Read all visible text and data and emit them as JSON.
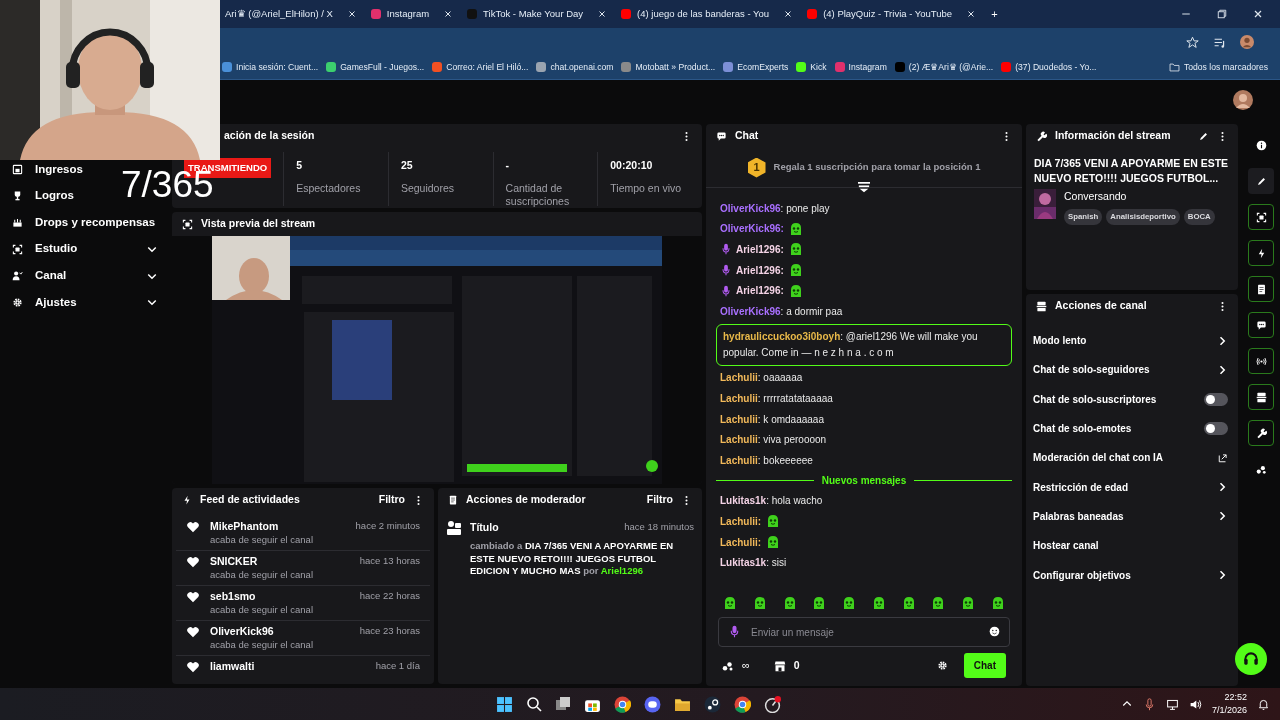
{
  "browser": {
    "tabs": [
      {
        "label": "Ari♛ (@Ariel_ElHilon) / X",
        "icon": false
      },
      {
        "label": "Instagram",
        "icon": true,
        "color": "#e1306c"
      },
      {
        "label": "TikTok - Make Your Day",
        "icon": true,
        "color": "#111111"
      },
      {
        "label": "(4) juego de las banderas - You",
        "icon": true,
        "color": "#ff0000"
      },
      {
        "label": "(4) PlayQuiz - Trivia - YouTube",
        "icon": true,
        "color": "#ff0000"
      }
    ],
    "new_tab": "+",
    "bookmarks": [
      {
        "label": "Inicia sesión: Cuent...",
        "color": "#4a90d9"
      },
      {
        "label": "GamesFull - Juegos...",
        "color": "#3ccf6e"
      },
      {
        "label": "Correo: Ariel El Hiló...",
        "color": "#f25022"
      },
      {
        "label": "chat.openai.com",
        "color": "#9aa4b0"
      },
      {
        "label": "Motobatt » Product...",
        "color": "#8a8a8a"
      },
      {
        "label": "EcomExperts",
        "color": "#7c8fd6"
      },
      {
        "label": "Kick",
        "color": "#53fc18"
      },
      {
        "label": "Instagram",
        "color": "#e1306c"
      },
      {
        "label": "(2) Æ♛Ari♛ (@Arie...",
        "color": "#000000"
      },
      {
        "label": "(37) Duodedos - Yo...",
        "color": "#ff0000"
      }
    ],
    "all_bookmarks": "Todos los marcadores"
  },
  "overlay_text": "7/365",
  "sidebar": [
    {
      "label": "Ingresos",
      "expandable": false
    },
    {
      "label": "Logros",
      "expandable": false
    },
    {
      "label": "Drops y recompensas",
      "expandable": false
    },
    {
      "label": "Estudio",
      "expandable": true
    },
    {
      "label": "Canal",
      "expandable": true
    },
    {
      "label": "Ajustes",
      "expandable": true
    }
  ],
  "session": {
    "title": "ación de la sesión",
    "status": "TRANSMITIENDO",
    "stats": [
      {
        "value": "5",
        "label": "Espectadores"
      },
      {
        "value": "25",
        "label": "Seguidores"
      },
      {
        "value": "-",
        "label": "Cantidad de suscripciones"
      },
      {
        "value": "00:20:10",
        "label": "Tiempo en vivo"
      }
    ]
  },
  "preview": {
    "title": "Vista previa del stream",
    "kind": "picture"
  },
  "feed": {
    "title": "Feed de actividades",
    "filter": "Filtro",
    "items": [
      {
        "name": "MikePhantom",
        "time": "hace 2 minutos",
        "text": "acaba de seguir el canal"
      },
      {
        "name": "SNICKER",
        "time": "hace 13 horas",
        "text": "acaba de seguir el canal"
      },
      {
        "name": "seb1smo",
        "time": "hace 22 horas",
        "text": "acaba de seguir el canal"
      },
      {
        "name": "OliverKick96",
        "time": "hace 23 horas",
        "text": "acaba de seguir el canal"
      },
      {
        "name": "liamwalti",
        "time": "hace 1 día"
      }
    ]
  },
  "moderator": {
    "title": "Acciones de moderador",
    "filter": "Filtro",
    "entries": [
      {
        "title": "Título",
        "time": "hace 18 minutos",
        "text": "cambiado a **DIA 7/365 VENI A APOYARME EN ESTE NUEVO RETO!!!! JUEGOS FUTBOL EDICION Y MUCHO MAS** por",
        "user": "Ariel1296"
      }
    ]
  },
  "chat": {
    "title": "Chat",
    "gift": {
      "rank": "1",
      "text": "Regala 1 suscripción para tomar la posición 1"
    },
    "messages": [
      {
        "kind": "text",
        "user": "OliverKick96",
        "color": "#a970ff",
        "text": "pone play",
        "mic": false,
        "highlighted": false
      },
      {
        "kind": "emote",
        "user": "OliverKick96",
        "color": "#a970ff",
        "mic": false,
        "highlighted": false
      },
      {
        "kind": "emote",
        "user": "Ariel1296",
        "color": "#f4d3e6",
        "mic": true,
        "highlighted": false
      },
      {
        "kind": "emote",
        "user": "Ariel1296",
        "color": "#f4d3e6",
        "mic": true,
        "highlighted": false
      },
      {
        "kind": "emote",
        "user": "Ariel1296",
        "color": "#f4d3e6",
        "mic": true,
        "highlighted": false
      },
      {
        "kind": "text",
        "user": "OliverKick96",
        "color": "#a970ff",
        "text": "a dormir paa",
        "mic": false,
        "highlighted": false
      },
      {
        "kind": "text",
        "user": "hydrauliccuckoo3i0boyh",
        "color": "#e9b949",
        "text": "@ariel1296 We will make you popular. Come in — n e z h n a . c o m",
        "mic": false,
        "highlighted": true
      },
      {
        "kind": "text",
        "user": "Lachulii",
        "color": "#f2b95a",
        "text": "oaaaaaa",
        "mic": false,
        "highlighted": false
      },
      {
        "kind": "text",
        "user": "Lachulii",
        "color": "#f2b95a",
        "text": "rrrrratatataaaaa",
        "mic": false,
        "highlighted": false
      },
      {
        "kind": "text",
        "user": "Lachulii",
        "color": "#f2b95a",
        "text": "k omdaaaaaa",
        "mic": false,
        "highlighted": false
      },
      {
        "kind": "text",
        "user": "Lachulii",
        "color": "#f2b95a",
        "text": "viva peroooon",
        "mic": false,
        "highlighted": false
      },
      {
        "kind": "text",
        "user": "Lachulii",
        "color": "#f2b95a",
        "text": "bokeeeeee",
        "mic": false,
        "highlighted": false
      },
      {
        "kind": "divider",
        "text": "Nuevos mensajes"
      },
      {
        "kind": "text",
        "user": "Lukitas1k",
        "color": "#f4d3e6",
        "text": "hola wacho",
        "mic": false,
        "highlighted": false
      },
      {
        "kind": "emote",
        "user": "Lachulii",
        "color": "#f2b95a",
        "mic": false,
        "highlighted": false
      },
      {
        "kind": "emote",
        "user": "Lachulii",
        "color": "#f2b95a",
        "mic": false,
        "highlighted": false
      },
      {
        "kind": "text",
        "user": "Lukitas1k",
        "color": "#f4d3e6",
        "text": "sisi",
        "mic": false,
        "highlighted": false
      }
    ],
    "separator": ":",
    "placeholder": "Enviar un mensaje",
    "points": "∞",
    "coins": "0",
    "send": "Chat"
  },
  "stream_info": {
    "title": "Información del stream",
    "stream_title": "DIA 7/365 VENI A APOYARME EN ESTE NUEVO RETO!!!! JUEGOS FUTBOL...",
    "category": "Conversando",
    "tags": [
      "Spanish",
      "Analisisdeportivo",
      "BOCA"
    ]
  },
  "channel_actions": {
    "title": "Acciones de canal",
    "items": [
      {
        "label": "Modo lento",
        "kind": "arrow"
      },
      {
        "label": "Chat de solo-seguidores",
        "kind": "arrow"
      },
      {
        "label": "Chat de solo-suscriptores",
        "kind": "toggle",
        "on": false
      },
      {
        "label": "Chat de solo-emotes",
        "kind": "toggle",
        "on": false
      },
      {
        "label": "Moderación del chat con IA",
        "kind": "external"
      },
      {
        "label": "Restricción de edad",
        "kind": "arrow"
      },
      {
        "label": "Palabras baneadas",
        "kind": "arrow"
      },
      {
        "label": "Hostear canal",
        "kind": "plain"
      },
      {
        "label": "Configurar objetivos",
        "kind": "arrow"
      }
    ]
  },
  "taskbar": {
    "time": "22:52",
    "date": "7/1/2026"
  }
}
